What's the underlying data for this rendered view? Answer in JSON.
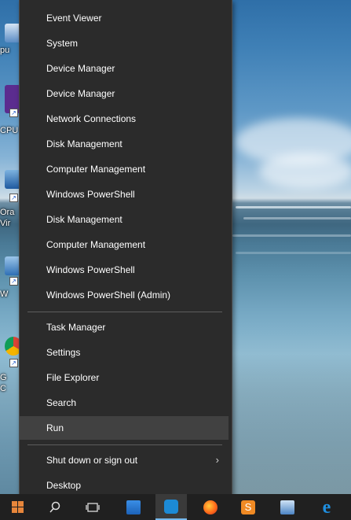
{
  "menu": {
    "items": [
      {
        "label": "Event Viewer"
      },
      {
        "label": "System"
      },
      {
        "label": "Device Manager"
      },
      {
        "label": "Device Manager"
      },
      {
        "label": "Network Connections"
      },
      {
        "label": "Disk Management"
      },
      {
        "label": "Computer Management"
      },
      {
        "label": "Windows PowerShell"
      },
      {
        "label": "Disk Management"
      },
      {
        "label": "Computer Management"
      },
      {
        "label": "Windows PowerShell"
      },
      {
        "label": "Windows PowerShell (Admin)"
      }
    ],
    "group2": [
      {
        "label": "Task Manager"
      },
      {
        "label": "Settings"
      },
      {
        "label": "File Explorer"
      },
      {
        "label": "Search"
      },
      {
        "label": "Run",
        "highlighted": true
      }
    ],
    "group3": [
      {
        "label": "Shut down or sign out",
        "has_submenu": true
      },
      {
        "label": "Desktop"
      }
    ],
    "colors": {
      "background": "#2b2b2b",
      "hover": "#414141",
      "text": "#ffffff",
      "separator": "#5d5d5d"
    }
  },
  "desktop": {
    "icons": [
      {
        "label": "pu",
        "icon": "computer-icon"
      },
      {
        "label": "CPU",
        "icon": "cpu-z-icon"
      },
      {
        "label": "Ora",
        "icon": "virtualbox-icon"
      },
      {
        "label": "Vir",
        "icon": "virtualbox-icon"
      },
      {
        "label": "W",
        "icon": "shortcut-icon"
      },
      {
        "label": "G",
        "icon": "chrome-icon"
      },
      {
        "label": "C",
        "icon": "chrome-icon"
      }
    ]
  },
  "taskbar": {
    "items": [
      {
        "icon": "start-icon"
      },
      {
        "icon": "search-icon"
      },
      {
        "icon": "task-view-icon"
      },
      {
        "icon": "store-icon"
      },
      {
        "icon": "app-icon",
        "active": true
      },
      {
        "icon": "firefox-icon"
      },
      {
        "icon": "sublime-icon"
      },
      {
        "icon": "remote-desktop-icon"
      },
      {
        "icon": "edge-icon"
      }
    ],
    "colors": {
      "background": "#202020",
      "accent": "#76b9ed"
    }
  }
}
